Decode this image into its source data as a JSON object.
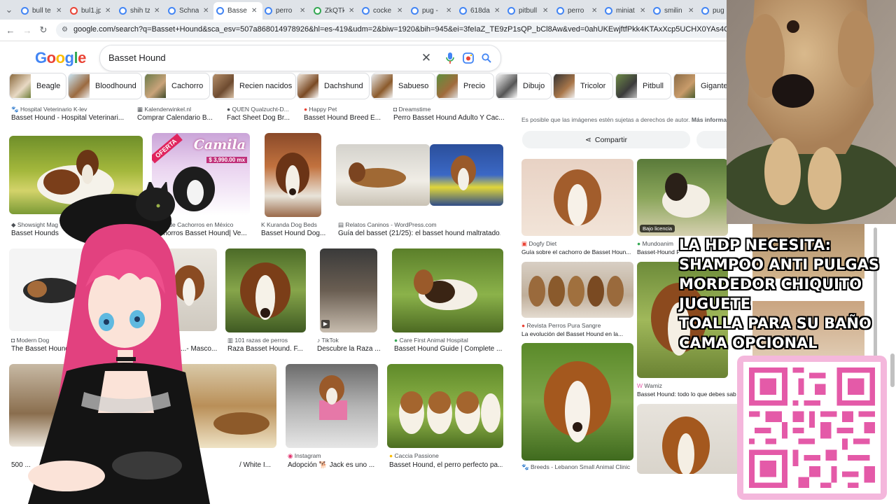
{
  "tabs": [
    {
      "label": "bull te",
      "fav": "b"
    },
    {
      "label": "bul1.jp",
      "fav": "r"
    },
    {
      "label": "shih tz",
      "fav": "b"
    },
    {
      "label": "Schna",
      "fav": "b"
    },
    {
      "label": "Basse",
      "fav": "b",
      "active": true
    },
    {
      "label": "perro",
      "fav": "b"
    },
    {
      "label": "ZkQTk",
      "fav": "g"
    },
    {
      "label": "cocke",
      "fav": "b"
    },
    {
      "label": "pug -",
      "fav": "b"
    },
    {
      "label": "618da",
      "fav": "b"
    },
    {
      "label": "pitbull",
      "fav": "b"
    },
    {
      "label": "perro",
      "fav": "b"
    },
    {
      "label": "miniat",
      "fav": "b"
    },
    {
      "label": "smilin",
      "fav": "b"
    },
    {
      "label": "pug r",
      "fav": "b"
    }
  ],
  "address_bar": {
    "url": "google.com/search?q=Basset+Hound&sca_esv=507a868014978926&hl=es-419&udm=2&biw=1920&bih=945&ei=3feIaZ_TE9zP1sQP_bCl8Aw&ved=0ahUKEwjftfPkk4KTAxXcp5UCHX0YAs4Q4dUDCBI&uact=5&oq=Basset+Hound"
  },
  "google": {
    "logo": "Google",
    "query": "Basset Hound"
  },
  "chips": [
    {
      "label": "Beagle"
    },
    {
      "label": "Bloodhound"
    },
    {
      "label": "Cachorro"
    },
    {
      "label": "Recien nacidos"
    },
    {
      "label": "Dachshund"
    },
    {
      "label": "Sabueso"
    },
    {
      "label": "Precio"
    },
    {
      "label": "Dibujo"
    },
    {
      "label": "Tricolor"
    },
    {
      "label": "Pitbull"
    },
    {
      "label": "Gigante"
    }
  ],
  "results": {
    "row0": [
      {
        "source": "Hospital Veterinario K-lev",
        "title": "Basset Hound - Hospital Veterinari..."
      },
      {
        "source": "Kalenderwinkel.nl",
        "title": "Comprar Calendario B..."
      },
      {
        "source": "QUEN Qualzucht-D...",
        "title": "Fact Sheet Dog Br..."
      },
      {
        "source": "Happy Pet",
        "title": "Basset Hound Breed E..."
      },
      {
        "source": "Dreamstime",
        "title": "Perro Basset Hound Adulto Y Cac..."
      }
    ],
    "row1": [
      {
        "source": "Showsight Mag",
        "title": "Basset Hounds"
      },
      {
        "source": "...nta de Cachorros en México",
        "title": "...chorros Basset Hound| Ve..."
      },
      {
        "source": "Kuranda Dog Beds",
        "title": "Basset Hound Dog..."
      },
      {
        "source": "Relatos Caninos - WordPress.com",
        "title": "Guía del basset (21/25): el basset hound maltratado..."
      }
    ],
    "row2": [
      {
        "source": "Modern Dog",
        "title": "The Basset Hound - Mod..."
      },
      {
        "source": "",
        "title": "...- Masco..."
      },
      {
        "source": "101 razas de perros",
        "title": "Raza Basset Hound. F..."
      },
      {
        "source": "TikTok",
        "title": "Descubre la Raza ..."
      },
      {
        "source": "Care First Animal Hospital",
        "title": "Basset Hound Guide | Complete ..."
      }
    ],
    "row3": [
      {
        "source": "",
        "title": "500 ..."
      },
      {
        "source": "",
        "title": "/ White I..."
      },
      {
        "source": "Instagram",
        "title": "Adopción 🐕 Jack es uno ..."
      },
      {
        "source": "Caccia Passione",
        "title": "Basset Hound, el perro perfecto pa..."
      }
    ],
    "offer_badge": "OFERTA",
    "offer_name": "Camila",
    "offer_price": "$ 3,990.00 mx"
  },
  "panel": {
    "copyright": "Es posible que las imágenes estén sujetas a derechos de autor.",
    "more_info": "Más información",
    "share": "Compartir",
    "related": [
      {
        "source": "Dogfy Diet",
        "title": "Guía sobre el cachorro de Basset Houn..."
      },
      {
        "source": "Mundoanim",
        "title": "Basset-Hound Perros Raza...",
        "badge": "Bajo licencia"
      },
      {
        "source": "Revista Perros Pura Sangre",
        "title": "La evolución del Basset Hound en la..."
      },
      {
        "source": "Wamiz",
        "title": "Basset Hound: todo lo que debes sab..."
      },
      {
        "source": "Breeds - Lebanon Small Animal Clinic",
        "title": ""
      }
    ]
  },
  "overlay": {
    "lines": [
      "LA HDP NECESITA:",
      "SHAMPOO ANTI PULGAS",
      "MORDEDOR CHIQUITO",
      "JUGUETE",
      "TOALLA PARA SU BAÑO",
      "CAMA OPCIONAL"
    ]
  },
  "colors": {
    "google_blue": "#4285f4",
    "google_red": "#ea4335",
    "google_yellow": "#fbbc05",
    "google_green": "#34a853",
    "qr_pink": "#e45aa8"
  }
}
